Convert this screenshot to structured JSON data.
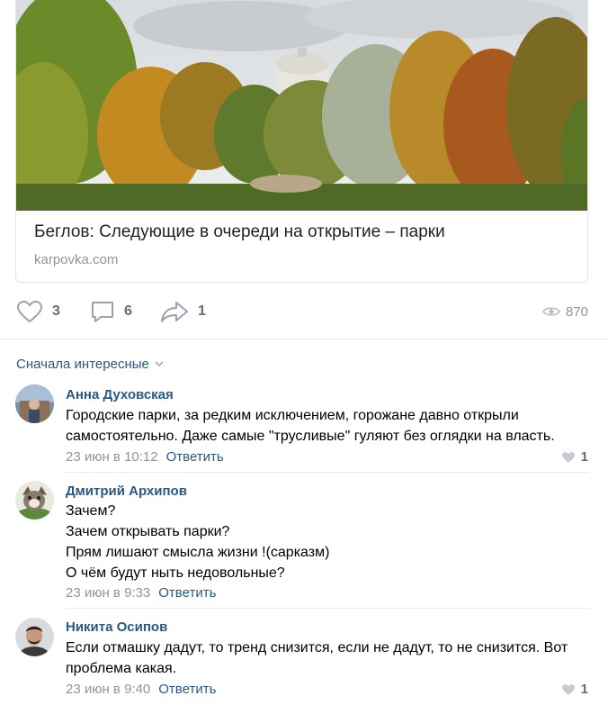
{
  "post": {
    "link": {
      "title": "Беглов: Следующие в очереди на открытие – парки",
      "domain": "karpovka.com"
    },
    "actions": {
      "likes": "3",
      "comments": "6",
      "shares": "1",
      "views": "870"
    }
  },
  "comments_header": {
    "sort_label": "Сначала интересные"
  },
  "comments": [
    {
      "author": "Анна Духовская",
      "lines": [
        "Городские парки, за редким исключением, горожане давно открыли",
        "самостоятельно. Даже самые \"трусливые\" гуляют без оглядки на власть."
      ],
      "date": "23 июн в 10:12",
      "reply_label": "Ответить",
      "likes": "1"
    },
    {
      "author": "Дмитрий Архипов",
      "lines": [
        "Зачем?",
        "Зачем открывать парки?",
        "Прям лишают смысла жизни !(сарказм)",
        "О чём будут ныть недовольные?"
      ],
      "date": "23 июн в 9:33",
      "reply_label": "Ответить",
      "likes": ""
    },
    {
      "author": "Никита Осипов",
      "lines": [
        "Если отмашку дадут, то тренд снизится, если не дадут, то не снизится. Вот",
        "проблема какая."
      ],
      "date": "23 июн в 9:40",
      "reply_label": "Ответить",
      "likes": "1"
    }
  ],
  "colors": {
    "link_blue": "#2a5885",
    "muted": "#939393",
    "icon": "#99a2ad"
  }
}
